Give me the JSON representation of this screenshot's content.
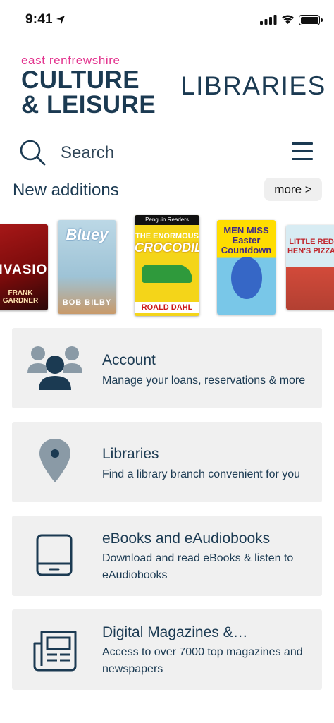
{
  "status_bar": {
    "time": "9:41"
  },
  "brand": {
    "org_name": "east renfrewshire",
    "line1": "CULTURE",
    "line2": "& LEISURE",
    "section_title": "LIBRARIES",
    "accent_color": "#e3358f",
    "primary_color": "#1b3a52"
  },
  "search": {
    "label": "Search",
    "icon": "search-icon"
  },
  "menu": {
    "icon": "hamburger-menu-icon"
  },
  "new_additions": {
    "title": "New additions",
    "more_label": "more >",
    "books": [
      {
        "cover_word": "NVASION",
        "author": "FRANK GARDNER"
      },
      {
        "cover_word": "Bluey",
        "author": "BOB BILBY"
      },
      {
        "series": "Penguin Readers",
        "title_line1": "THE ENORMOUS",
        "title_line2": "CROCODILE",
        "author": "ROALD DAHL"
      },
      {
        "title": "MEN MISS Easter Countdown"
      },
      {
        "title": "LITTLE RED HEN'S PIZZA"
      }
    ]
  },
  "cards": [
    {
      "title": "Account",
      "description": "Manage your loans, reservations & more",
      "icon": "account-group-icon"
    },
    {
      "title": "Libraries",
      "description": "Find a library branch convenient for you",
      "icon": "location-pin-icon"
    },
    {
      "title": "eBooks and eAudiobooks",
      "description": "Download and read eBooks & listen to eAudiobooks",
      "icon": "tablet-icon"
    },
    {
      "title": "Digital Magazines &…",
      "description": "Access to over 7000 top magazines and newspapers",
      "icon": "newspaper-icon"
    }
  ]
}
